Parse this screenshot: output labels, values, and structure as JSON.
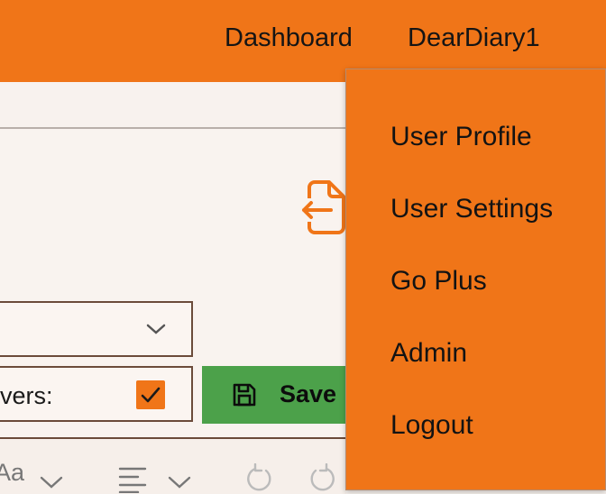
{
  "header": {
    "nav": [
      "Dashboard",
      "DearDiary1"
    ]
  },
  "form": {
    "checkbox_label": "vers:",
    "checkbox_checked": true,
    "save_label": "Save"
  },
  "toolbar": {
    "font_label": "Aa"
  },
  "user_menu": {
    "items": [
      "User Profile",
      "User Settings",
      "Go Plus",
      "Admin",
      "Logout"
    ]
  },
  "colors": {
    "brand": "#f07518",
    "save": "#4ca14a",
    "border": "#6b4b3a"
  },
  "icons": [
    "file-export-icon",
    "chevron-down-icon",
    "check-icon",
    "save-icon",
    "align-left-icon",
    "undo-icon",
    "redo-icon"
  ]
}
